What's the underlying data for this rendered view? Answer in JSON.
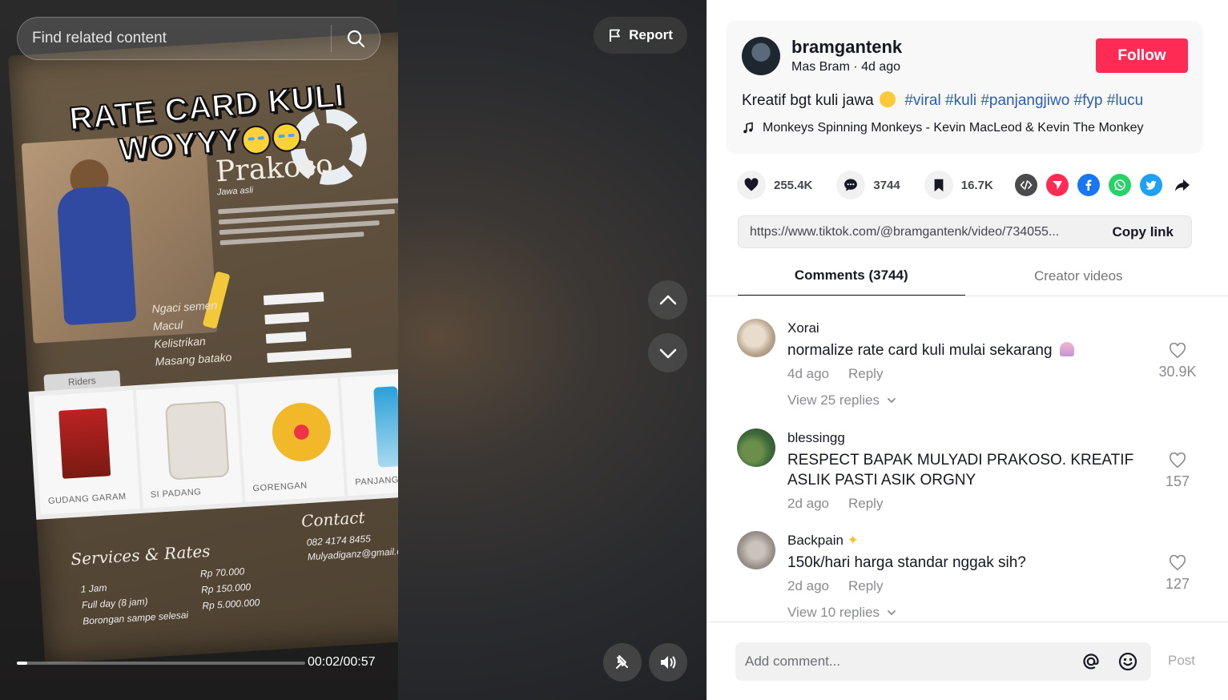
{
  "video": {
    "search_placeholder": "Find related content",
    "report_label": "Report",
    "overlay_title_line1": "RATE CARD KULI",
    "overlay_title_line2": "WOYYY",
    "time_current": "00:02",
    "time_total": "00:57",
    "progress_fraction": 0.035,
    "card": {
      "name": "Prakoso",
      "sub": "Jawa asli",
      "skills": [
        "Ngaci semen",
        "Macul",
        "Kelistrikan",
        "Masang batako"
      ],
      "riders_label": "Riders",
      "riders": [
        "GUDANG GARAM",
        "SI PADANG",
        "GORENGAN",
        "PANJANG"
      ],
      "contact_title": "Contact",
      "contact_phone": "082 4174 8455",
      "contact_email": "Mulyadiganz@gmail.com",
      "rates_title": "Services & Rates",
      "rates": [
        "1 Jam",
        "Full day (8 jam)",
        "Borongan sampe selesai"
      ],
      "rate_values": [
        "Rp 70.000",
        "Rp 150.000",
        "Rp 5.000.000"
      ]
    }
  },
  "post": {
    "username": "bramgantenk",
    "nickname": "Mas Bram",
    "age": "4d ago",
    "follow_label": "Follow",
    "description_text": "Kreatif bgt kuli jawa",
    "hashtags": [
      "#viral",
      "#kuli",
      "#panjangjiwo",
      "#fyp",
      "#lucu"
    ],
    "music": "Monkeys Spinning Monkeys - Kevin MacLeod & Kevin The Monkey",
    "likes": "255.4K",
    "comments": "3744",
    "saves": "16.7K",
    "share_icons": [
      "embed-icon",
      "send-icon",
      "facebook-icon",
      "whatsapp-icon",
      "twitter-icon",
      "share-arrow-icon"
    ],
    "link": "https://www.tiktok.com/@bramgantenk/video/734055...",
    "copy_label": "Copy link"
  },
  "tabs": {
    "comments_label": "Comments (3744)",
    "creator_label": "Creator videos"
  },
  "comments": [
    {
      "user": "Xorai",
      "text": "normalize rate card kuli mulai sekarang",
      "age": "4d ago",
      "reply": "Reply",
      "likes": "30.9K",
      "replies": "View 25 replies"
    },
    {
      "user": "blessingg",
      "text": "RESPECT BAPAK MULYADI PRAKOSO. KREATIF ASLIK PASTI ASIK ORGNY",
      "age": "2d ago",
      "reply": "Reply",
      "likes": "157"
    },
    {
      "user": "Backpain",
      "text": "150k/hari harga standar nggak sih?",
      "age": "2d ago",
      "reply": "Reply",
      "likes": "127",
      "replies": "View 10 replies"
    }
  ],
  "composer": {
    "placeholder": "Add comment...",
    "post_label": "Post"
  },
  "colors": {
    "accent": "#fe2c55",
    "hashtag": "#2b5db9"
  }
}
